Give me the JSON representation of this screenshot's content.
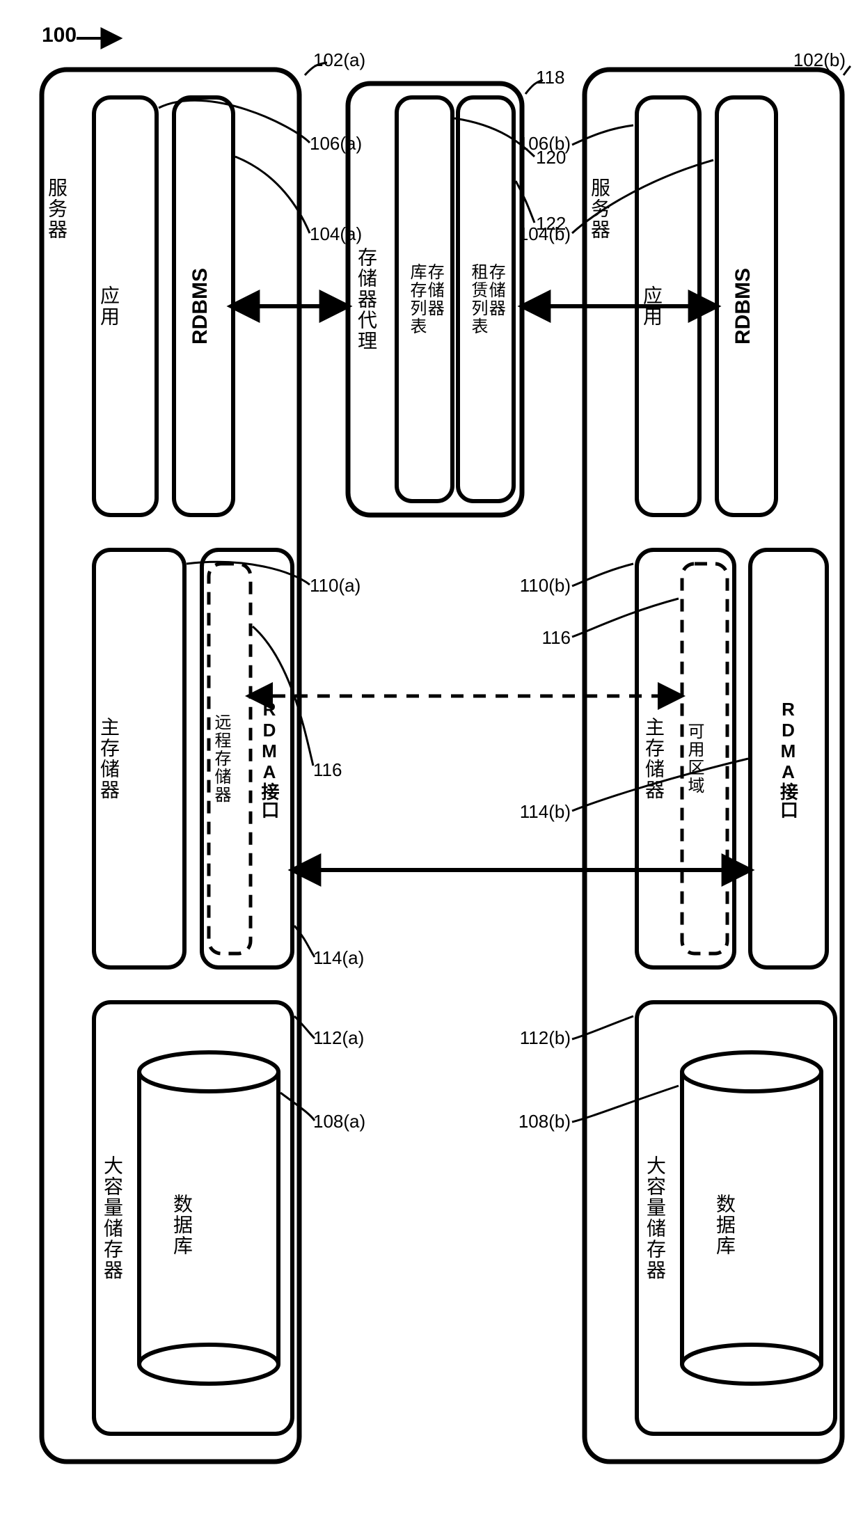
{
  "figure_number": "100",
  "broker": {
    "title": "存储器代理",
    "inventory": "存储器\n库存列表",
    "lease": "存储器\n租赁列表",
    "ref": "118",
    "ref_inventory": "120",
    "ref_lease": "122"
  },
  "server_a": {
    "title": "服务器",
    "app": "应用",
    "rdbms": "RDBMS",
    "main_mem": "主存储器",
    "remote_mem": "远程存储器",
    "rdma": "RDMA接口",
    "mass": "大容量储存器",
    "db": "数据库",
    "refs": {
      "server": "102(a)",
      "app": "106(a)",
      "rdbms": "104(a)",
      "mainmem": "110(a)",
      "remote_avail": "116",
      "rdma": "114(a)",
      "mass": "112(a)",
      "db": "108(a)"
    }
  },
  "server_b": {
    "title": "服务器",
    "app": "应用",
    "rdbms": "RDBMS",
    "main_mem": "主存储器",
    "avail_region": "可用区域",
    "rdma": "RDMA接口",
    "mass": "大容量储存器",
    "db": "数据库",
    "refs": {
      "server": "102(b)",
      "app": "106(b)",
      "rdbms": "104(b)",
      "mainmem": "110(b)",
      "remote_avail": "116",
      "rdma": "114(b)",
      "mass": "112(b)",
      "db": "108(b)"
    }
  }
}
